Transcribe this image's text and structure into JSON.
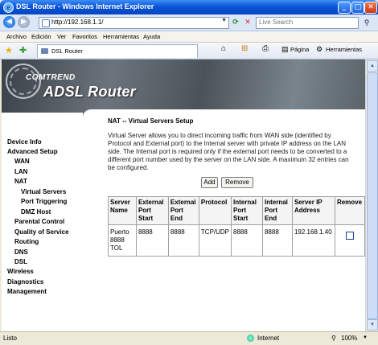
{
  "window": {
    "title": "DSL Router - Windows Internet Explorer",
    "minimize": "_",
    "maximize": "□",
    "close": "✕"
  },
  "addressbar": {
    "url": "http://192.168.1.1/",
    "search_placeholder": "Live Search"
  },
  "menu": [
    "Archivo",
    "Edición",
    "Ver",
    "Favoritos",
    "Herramientas",
    "Ayuda"
  ],
  "tab": {
    "label": "DSL Router"
  },
  "toolbar": {
    "page": "Página",
    "tools": "Herramientas"
  },
  "banner": {
    "brand": "COMTREND",
    "product": "ADSL Router"
  },
  "sidebar": [
    "Device Info",
    "Advanced Setup",
    "WAN",
    "LAN",
    "NAT",
    "Virtual Servers",
    "Port Triggering",
    "DMZ Host",
    "Parental Control",
    "Quality of Service",
    "Routing",
    "DNS",
    "DSL",
    "Wireless",
    "Diagnostics",
    "Management"
  ],
  "main": {
    "title": "NAT -- Virtual Servers Setup",
    "description": "Virtual Server allows you to direct incoming traffic from WAN side (identified by Protocol and External port) to the Internal server with private IP address on the LAN side. The Internal port is required only if the external port needs to be converted to a different port number used by the server on the LAN side. A maximum 32 entries can be configured.",
    "add_label": "Add",
    "remove_label": "Remove"
  },
  "table": {
    "headers": [
      "Server Name",
      "External Port Start",
      "External Port End",
      "Protocol",
      "Internal Port Start",
      "Internal Port End",
      "Server IP Address",
      "Remove"
    ],
    "rows": [
      {
        "server_name": "Puerto 8888 TOL",
        "ext_start": "8888",
        "ext_end": "8888",
        "protocol": "TCP/UDP",
        "int_start": "8888",
        "int_end": "8888",
        "server_ip": "192.168.1.40",
        "remove": false
      }
    ]
  },
  "status": {
    "left": "Listo",
    "zone": "Internet",
    "zoom": "100%"
  }
}
